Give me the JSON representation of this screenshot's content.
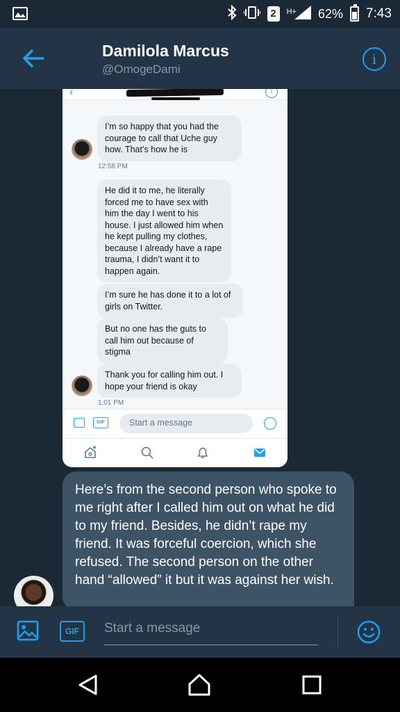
{
  "status_bar": {
    "sim_slot": "2",
    "network": "H+",
    "battery": "62%",
    "time": "7:43"
  },
  "header": {
    "name": "Damilola Marcus",
    "handle": "@OmogeDami"
  },
  "embedded_screenshot": {
    "messages": [
      {
        "text": "I’m so happy that you had the courage to call that Uche guy how. That’s how he is"
      },
      {
        "text": "He did it to me, he literally forced me to have sex with him the day I went to his house. I just allowed him when he kept pulling my clothes, because I already have a rape trauma, I didn’t want it to happen again."
      },
      {
        "text": "I’m sure he has done it to a lot of girls on Twitter."
      },
      {
        "text": "But no one has the guts to call him out because of stigma"
      },
      {
        "text": "Thank you for calling him out. I hope your friend is okay"
      }
    ],
    "times": [
      "12:58 PM",
      "1:01 PM"
    ],
    "composer_placeholder": "Start a message",
    "gif_label": "GIF"
  },
  "message": {
    "text": "Here’s from the second person who spoke to me right after I called him out on what he did to my friend. Besides, he didn’t rape my friend. It was forceful coercion, which she refused. The second person on the other hand “allowed” it but it was against her wish."
  },
  "composer": {
    "placeholder": "Start a message",
    "gif_label": "GIF"
  },
  "colors": {
    "accent": "#1da1f2",
    "background": "#1b2836",
    "header": "#243447",
    "bubble": "#3d5466"
  }
}
